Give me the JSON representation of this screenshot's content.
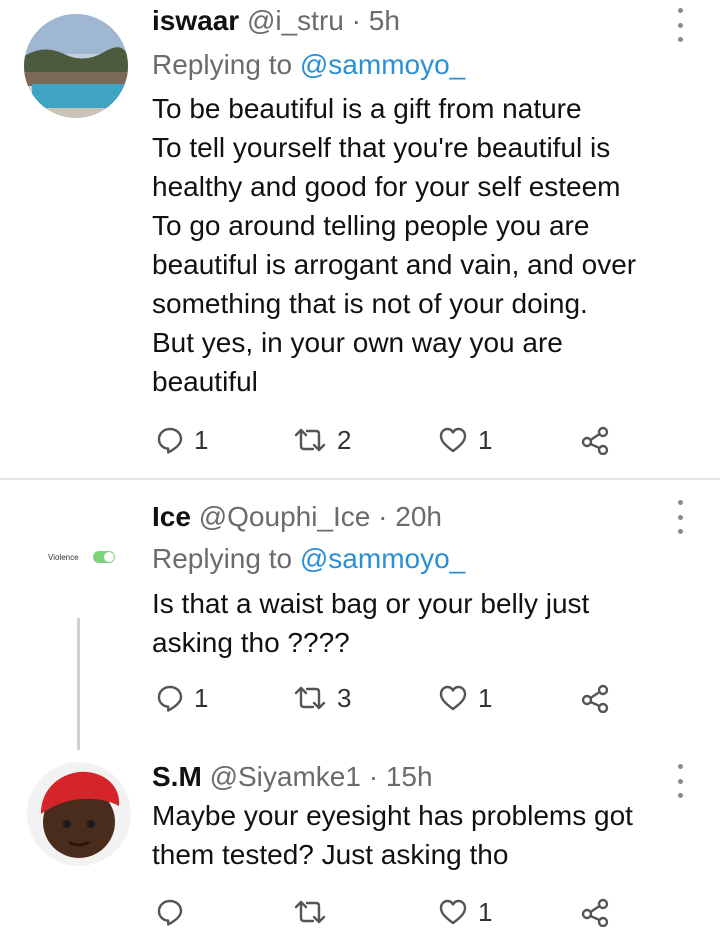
{
  "tweets": [
    {
      "name": "iswaar",
      "handle": "@i_stru",
      "time": "· 5h",
      "replying_prefix": "Replying to",
      "replying_to": "@sammoyo_",
      "lines": [
        "To be beautiful is a gift from nature",
        "To tell yourself that you're beautiful is",
        "healthy and good for your self esteem",
        "To go around telling people you are",
        "beautiful is arrogant and vain, and over",
        "something that is not of your doing.",
        "But yes, in your own way you are",
        "beautiful"
      ],
      "replies": "1",
      "retweets": "2",
      "likes": "1"
    },
    {
      "name": "Ice",
      "handle": "@Qouphi_Ice",
      "time": "· 20h",
      "replying_prefix": "Replying to",
      "replying_to": "@sammoyo_",
      "lines": [
        "Is that a waist bag or your belly just",
        "asking tho ????"
      ],
      "replies": "1",
      "retweets": "3",
      "likes": "1",
      "avatar_label": "Violence"
    },
    {
      "name": "S.M",
      "handle": "@Siyamke1",
      "time": "· 15h",
      "lines": [
        "Maybe your eyesight has problems got",
        "them tested? Just asking tho"
      ],
      "replies": "",
      "retweets": "",
      "likes": "1"
    }
  ],
  "icons": {
    "reply": "reply-icon",
    "retweet": "retweet-icon",
    "like": "heart-icon",
    "share": "share-icon",
    "more": "more-vertical-icon"
  },
  "colors": {
    "link": "#2b8fd6",
    "meta": "#6b6b6b",
    "icon": "#555555"
  }
}
